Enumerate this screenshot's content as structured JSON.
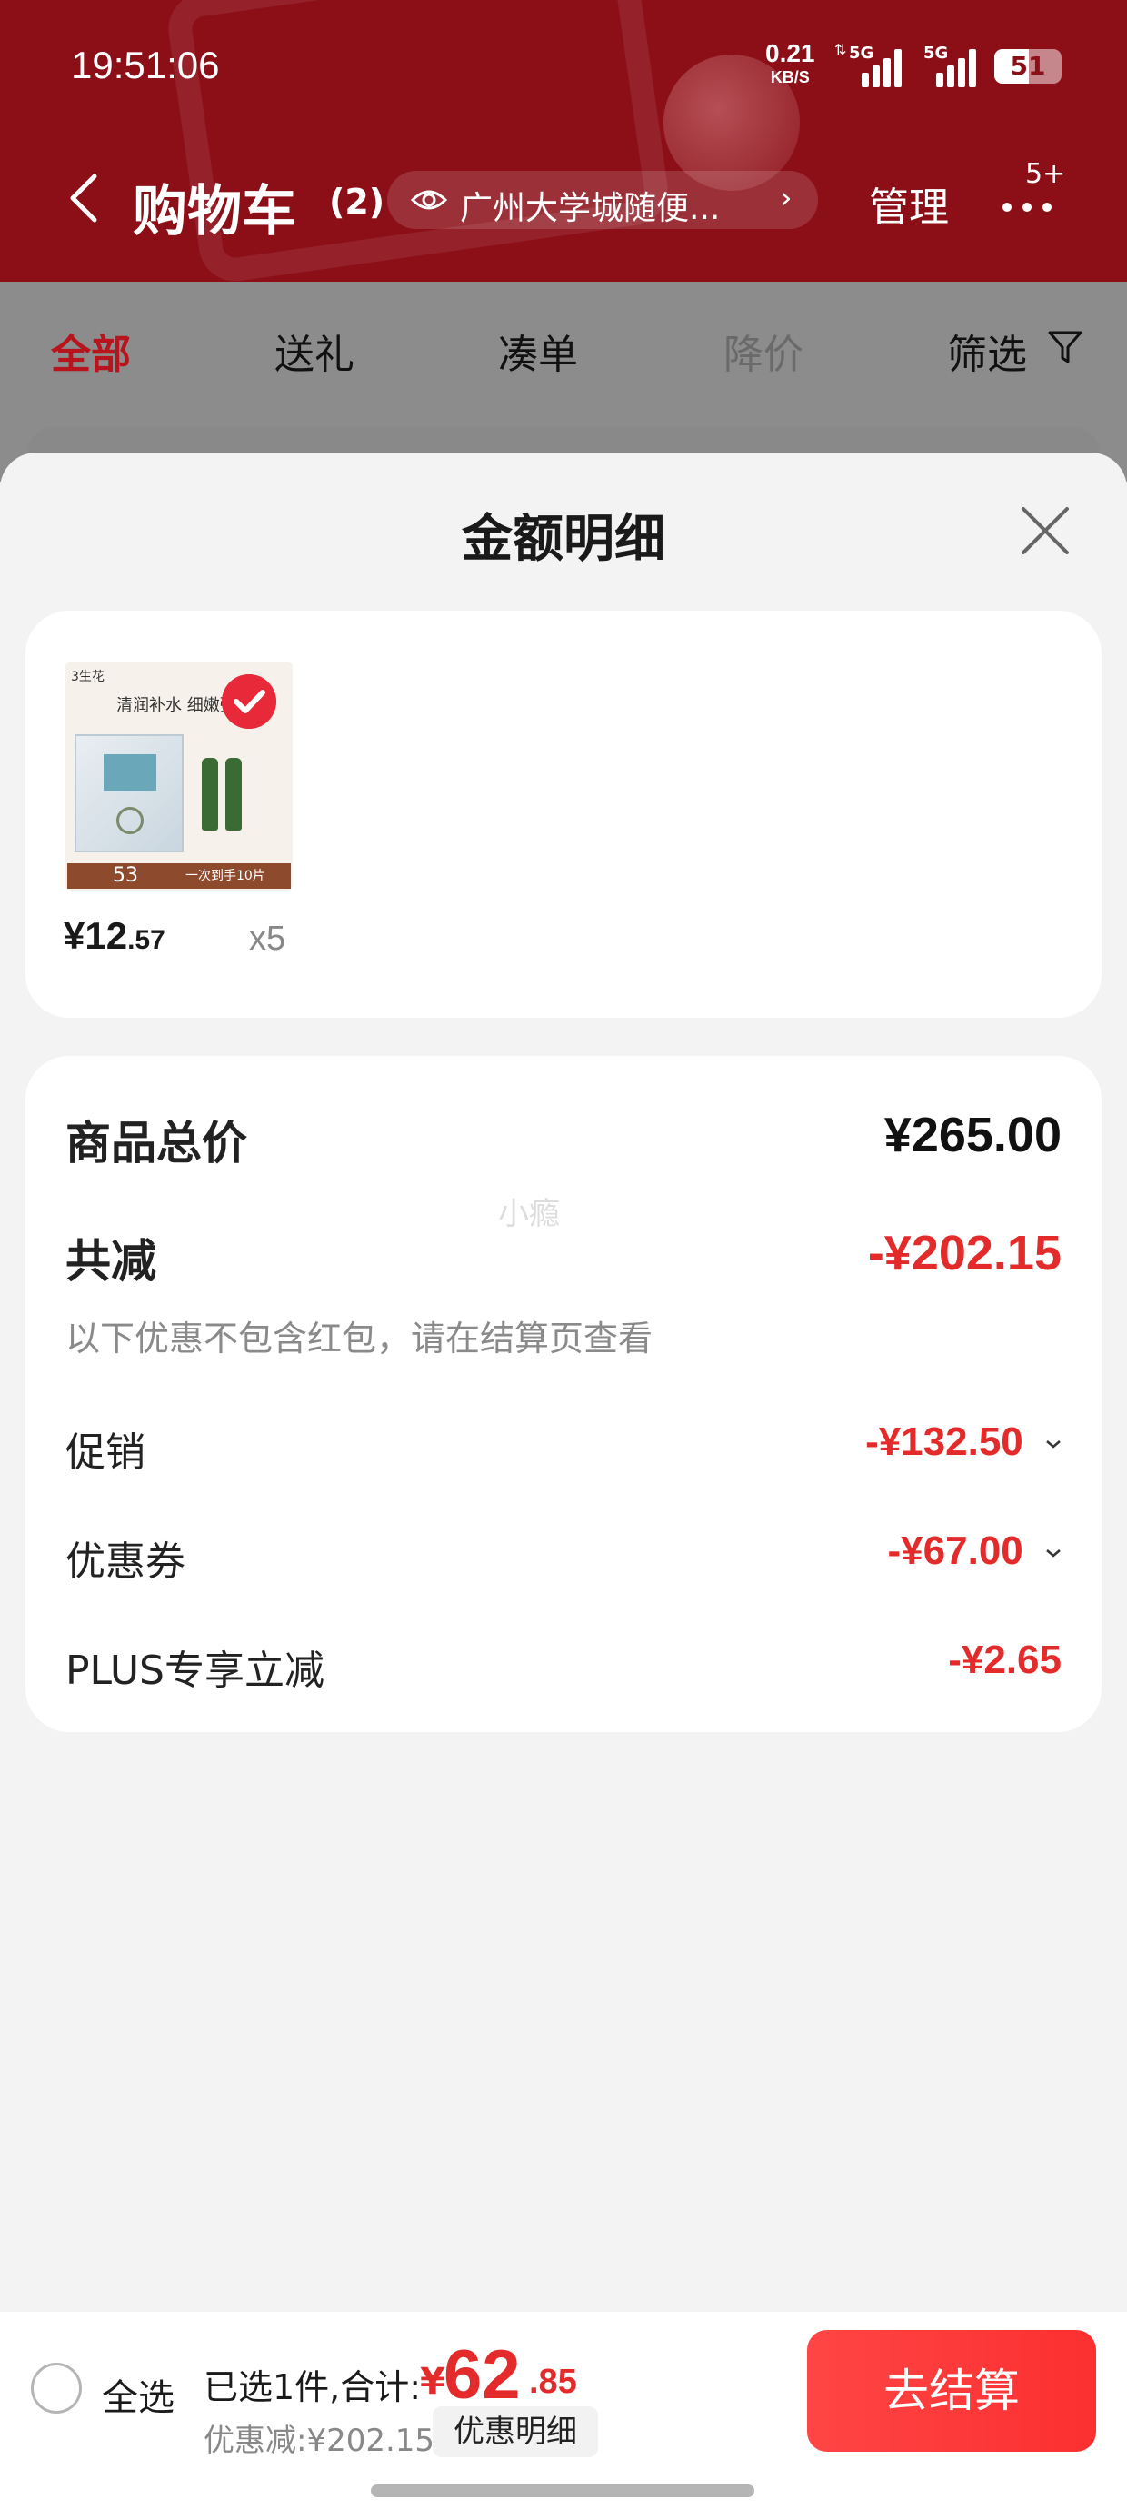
{
  "status": {
    "time": "19:51:06",
    "speed_value": "0.21",
    "speed_unit": "KB/S",
    "net1": "5G",
    "net2": "5G",
    "battery": "51"
  },
  "nav": {
    "title": "购物车",
    "count": "(2)",
    "location": "广州大学城随便...",
    "manage": "管理",
    "badge": "5+"
  },
  "tabs": [
    "全部",
    "送礼",
    "凑单",
    "降价",
    "筛选"
  ],
  "sheet": {
    "title": "金额明细",
    "product": {
      "brand_text": "3生花",
      "slogan": "清润补水 细嫩弹",
      "strip_number": "53",
      "strip_text": "一次到手10片",
      "price_symbol": "¥",
      "price_int": "12",
      "price_dec": ".57",
      "qty": "x5"
    },
    "summary": {
      "total_label": "商品总价",
      "total_value": "¥265.00",
      "reduce_label": "共减",
      "reduce_value": "-¥202.15",
      "note": "以下优惠不包含红包，请在结算页查看",
      "watermark": "小瘾",
      "items": [
        {
          "label": "促销",
          "value": "-¥132.50"
        },
        {
          "label": "优惠券",
          "value": "-¥67.00"
        },
        {
          "label": "PLUS专享立减",
          "value": "-¥2.65"
        }
      ]
    }
  },
  "bottom": {
    "select_all": "全选",
    "selected": "已选1件,合计:",
    "total_symbol": "¥",
    "total_int": "62",
    "total_dec": ".85",
    "discount": "优惠减:¥202.15",
    "detail_button": "优惠明细",
    "checkout": "去结算"
  },
  "colors": {
    "header": "#8c0f18",
    "accent_red": "#e42b2b",
    "checkout": "#fb2f2f"
  }
}
